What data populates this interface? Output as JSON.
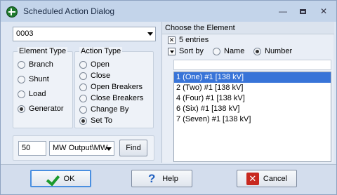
{
  "window": {
    "title": "Scheduled Action Dialog"
  },
  "titlebar": {
    "minimize": "—",
    "close": "✕"
  },
  "left": {
    "selector_value": "0003",
    "element_type": {
      "title": "Element Type",
      "options": [
        "Branch",
        "Shunt",
        "Load",
        "Generator"
      ],
      "selected": "Generator"
    },
    "action_type": {
      "title": "Action Type",
      "options": [
        "Open",
        "Close",
        "Open Breakers",
        "Close Breakers",
        "Change By",
        "Set To"
      ],
      "selected": "Set To"
    },
    "find": {
      "value": "50",
      "unit": "MW Output\\MW",
      "button": "Find"
    }
  },
  "right": {
    "header": "Choose the Element",
    "entries_label": "5 entries",
    "sort_by_label": "Sort by",
    "sort_options": [
      "Name",
      "Number"
    ],
    "sort_selected": "Number",
    "filter_value": "",
    "items": [
      "1 (One) #1  [138 kV]",
      "2 (Two) #1  [138 kV]",
      "4 (Four) #1  [138 kV]",
      "6 (Six) #1  [138 kV]",
      "7 (Seven) #1  [138 kV]"
    ],
    "selected_index": 0
  },
  "buttons": {
    "ok": "OK",
    "help": "Help",
    "cancel": "Cancel"
  }
}
